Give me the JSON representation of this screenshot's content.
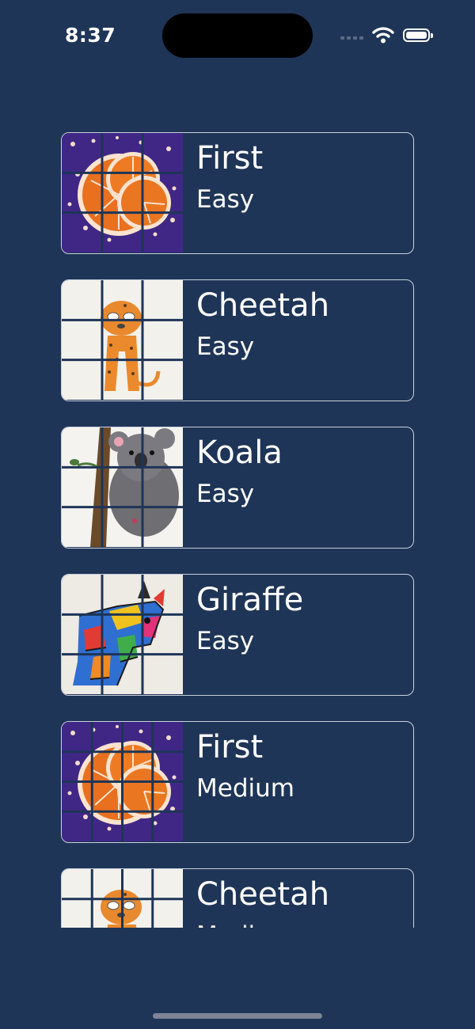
{
  "status_bar": {
    "time": "8:37",
    "icons": [
      "cellular-signal-icon",
      "wifi-icon",
      "battery-icon"
    ]
  },
  "puzzles": [
    {
      "title": "First",
      "level": "Easy",
      "image": "orange-slices-painting",
      "grid": 3
    },
    {
      "title": "Cheetah",
      "level": "Easy",
      "image": "cheetah-drawing",
      "grid": 3
    },
    {
      "title": "Koala",
      "level": "Easy",
      "image": "koala-drawing",
      "grid": 3
    },
    {
      "title": "Giraffe",
      "level": "Easy",
      "image": "colorful-giraffe-drawing",
      "grid": 3
    },
    {
      "title": "First",
      "level": "Medium",
      "image": "orange-slices-painting",
      "grid": 4
    },
    {
      "title": "Cheetah",
      "level": "Medium",
      "image": "cheetah-drawing",
      "grid": 4
    }
  ],
  "colors": {
    "background": "#1e3557",
    "card_border": "#c9d1dc",
    "grid_lines": "#1e3557"
  }
}
